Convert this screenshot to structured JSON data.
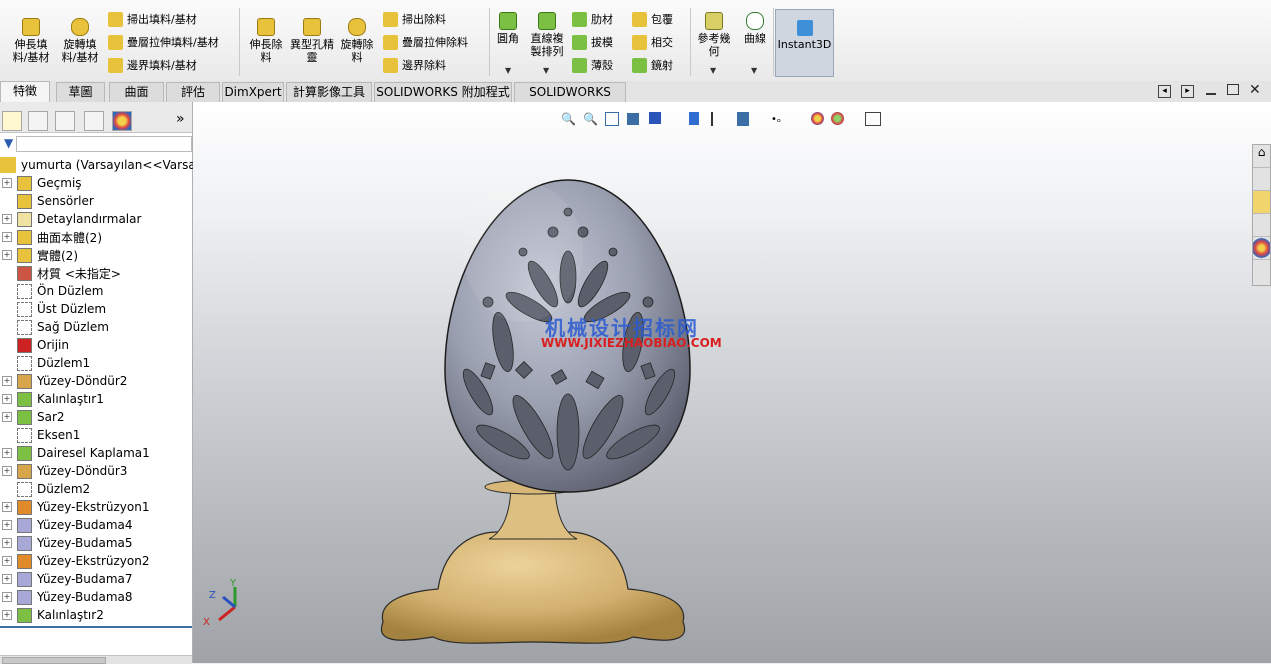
{
  "ribbon": {
    "extrude_boss": "伸長填料/基材",
    "revolve_boss": "旋轉填料/基材",
    "sweep_boss": "掃出填料/基材",
    "loft_boss": "疊層拉伸填料/基材",
    "boundary_boss": "邊界填料/基材",
    "extrude_cut": "伸長除料",
    "hole_wizard": "異型孔精靈",
    "revolve_cut": "旋轉除料",
    "sweep_cut": "掃出除料",
    "loft_cut": "疊層拉伸除料",
    "boundary_cut": "邊界除料",
    "fillet": "圓角",
    "linear_pattern": "直線複製排列",
    "rib": "肋材",
    "draft": "拔模",
    "shell": "薄殼",
    "wrap": "包覆",
    "intersect": "相交",
    "mirror": "鏡射",
    "ref_geometry": "參考幾何",
    "curves": "曲線",
    "instant3d": "Instant3D"
  },
  "tabs": [
    "特徵",
    "草圖",
    "曲面",
    "評估",
    "DimXpert",
    "計算影像工具",
    "SOLIDWORKS 附加程式",
    "SOLIDWORKS MBD"
  ],
  "tree": {
    "root": "yumurta  (Varsayılan<<Varsayı",
    "items": [
      {
        "label": "Geçmiş",
        "icon": "history-icon",
        "expand": true
      },
      {
        "label": "Sensörler",
        "icon": "sensor-icon",
        "expand": false
      },
      {
        "label": "Detaylandırmalar",
        "icon": "annotation-icon",
        "expand": true
      },
      {
        "label": "曲面本體(2)",
        "icon": "surface-bodies-icon",
        "expand": true
      },
      {
        "label": "實體(2)",
        "icon": "solid-bodies-icon",
        "expand": true
      },
      {
        "label": "材質 <未指定>",
        "icon": "material-icon",
        "expand": false
      },
      {
        "label": "Ön Düzlem",
        "icon": "plane-icon",
        "expand": false
      },
      {
        "label": "Üst Düzlem",
        "icon": "plane-icon",
        "expand": false
      },
      {
        "label": "Sağ Düzlem",
        "icon": "plane-icon",
        "expand": false
      },
      {
        "label": "Orijin",
        "icon": "origin-icon",
        "expand": false
      },
      {
        "label": "Düzlem1",
        "icon": "plane-icon",
        "expand": false
      },
      {
        "label": "Yüzey-Döndür2",
        "icon": "surface-revolve-icon",
        "expand": true
      },
      {
        "label": "Kalınlaştır1",
        "icon": "thicken-icon",
        "expand": true
      },
      {
        "label": "Sar2",
        "icon": "wrap-icon",
        "expand": true
      },
      {
        "label": "Eksen1",
        "icon": "axis-icon",
        "expand": false
      },
      {
        "label": "Dairesel Kaplama1",
        "icon": "circular-pattern-icon",
        "expand": true
      },
      {
        "label": "Yüzey-Döndür3",
        "icon": "surface-revolve-icon",
        "expand": true
      },
      {
        "label": "Düzlem2",
        "icon": "plane-icon",
        "expand": false
      },
      {
        "label": "Yüzey-Ekstrüzyon1",
        "icon": "surface-extrude-icon",
        "expand": true
      },
      {
        "label": "Yüzey-Budama4",
        "icon": "surface-trim-icon",
        "expand": true
      },
      {
        "label": "Yüzey-Budama5",
        "icon": "surface-trim-icon",
        "expand": true
      },
      {
        "label": "Yüzey-Ekstrüzyon2",
        "icon": "surface-extrude-icon",
        "expand": true
      },
      {
        "label": "Yüzey-Budama7",
        "icon": "surface-trim-icon",
        "expand": true
      },
      {
        "label": "Yüzey-Budama8",
        "icon": "surface-trim-icon",
        "expand": true
      },
      {
        "label": "Kalınlaştır2",
        "icon": "thicken-icon",
        "expand": true
      }
    ]
  },
  "viewport": {
    "watermark_cn": "机械设计招标网",
    "watermark_url": "WWW.JIXIEZHAOBIAO.COM",
    "triad": {
      "x": "X",
      "y": "Y",
      "z": "Z"
    }
  },
  "colors": {
    "accent": "#3a6ea5",
    "egg": "#a3a8b8",
    "base": "#d2b06f"
  }
}
